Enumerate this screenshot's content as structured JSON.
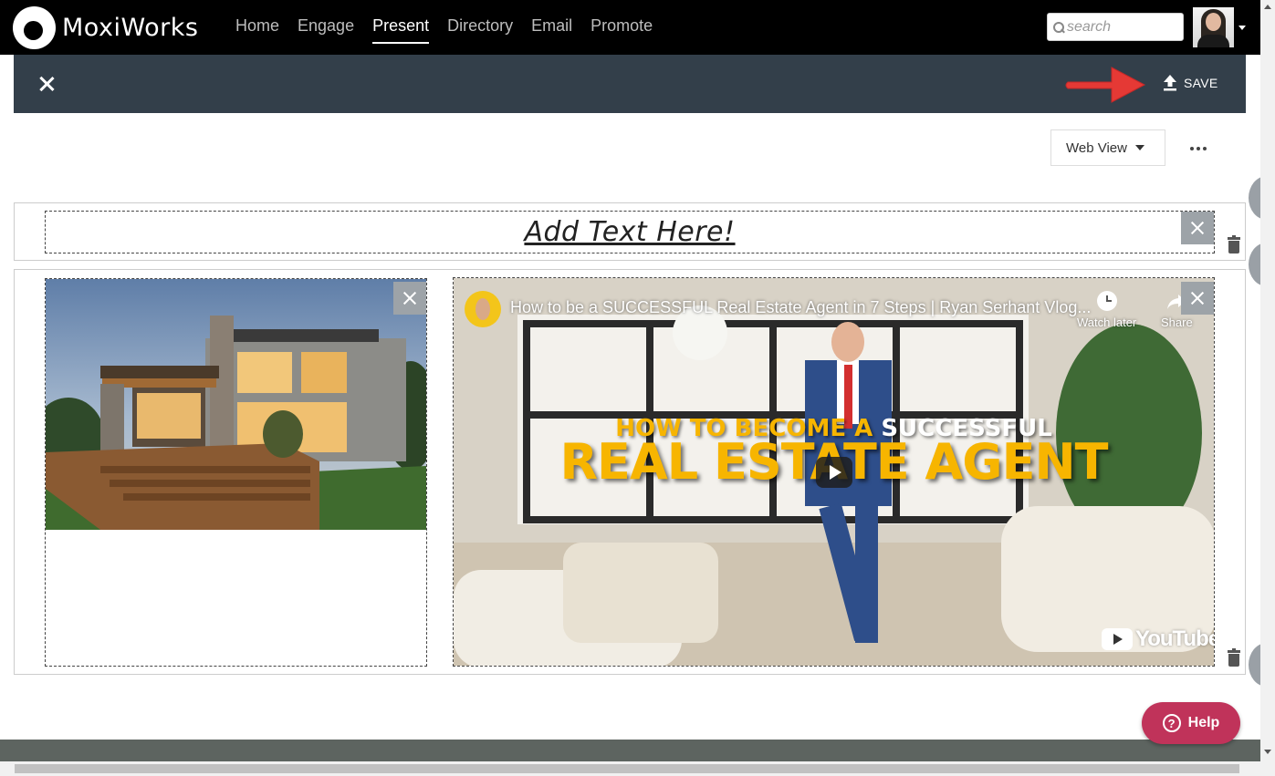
{
  "header": {
    "logo_text": "MoxiWorks",
    "nav": [
      {
        "label": "Home",
        "active": false
      },
      {
        "label": "Engage",
        "active": false
      },
      {
        "label": "Present",
        "active": true
      },
      {
        "label": "Directory",
        "active": false
      },
      {
        "label": "Email",
        "active": false
      },
      {
        "label": "Promote",
        "active": false
      }
    ],
    "search_placeholder": "search"
  },
  "toolbar": {
    "save_label": "SAVE"
  },
  "controls": {
    "view_select": "Web View"
  },
  "blocks": {
    "text_block": "Add Text Here!",
    "video": {
      "title": "How to be a SUCCESSFUL Real Estate Agent in 7 Steps | Ryan Serhant Vlog...",
      "watch_later": "Watch later",
      "share": "Share",
      "headline_line1_a": "HOW TO BECOME A ",
      "headline_line1_b": "SUCCESSFUL",
      "headline_line2": "REAL ESTATE AGENT",
      "brand": "YouTube"
    }
  },
  "help": {
    "label": "Help"
  },
  "colors": {
    "topbar": "#000000",
    "toolbar": "#333f4a",
    "help": "#c0335a",
    "arrow": "#e53935"
  }
}
